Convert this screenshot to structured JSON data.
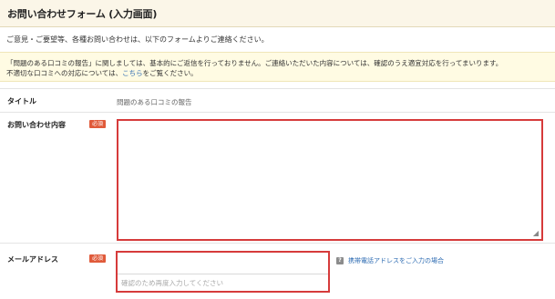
{
  "header": {
    "title": "お問い合わせフォーム (入力画面)"
  },
  "intro": "ご意見・ご要望等、各種お問い合わせは、以下のフォームよりご連絡ください。",
  "notice": {
    "line1": "「問題のある口コミの報告」に関しましては、基本的にご返信を行っておりません。ご連絡いただいた内容については、確認のうえ適宜対応を行ってまいります。",
    "line2_pre": "不適切な口コミへの対応については、",
    "link": "こちら",
    "line2_post": "をご覧ください。"
  },
  "fields": {
    "title": {
      "label": "タイトル",
      "value": "問題のある口コミの報告"
    },
    "message": {
      "label": "お問い合わせ内容",
      "required": "必須",
      "value": ""
    },
    "email": {
      "label": "メールアドレス",
      "required": "必須",
      "value": "",
      "confirm_placeholder": "確認のため再度入力してください",
      "help_icon": "?",
      "help_link": "携帯電話アドレスをご入力の場合"
    }
  },
  "colors": {
    "required_badge": "#e05a3a",
    "error_border": "#d63b3b",
    "link": "#2f6db3",
    "header_bg": "#fbf6e8",
    "notice_bg": "#fffbe3"
  }
}
